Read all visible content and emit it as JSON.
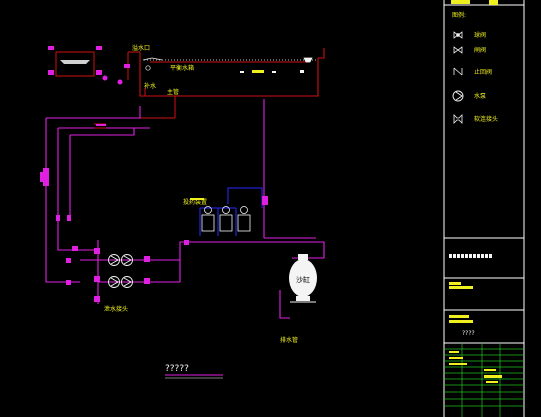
{
  "colors": {
    "background": "#000000",
    "supply_pipe": "#d01010",
    "circulation_pipe": "#e020e0",
    "dosing_pipe": "#2a2aff",
    "frame": "#ffffff",
    "table_line": "#20c020",
    "annotation": "#f0f020"
  },
  "labels": {
    "overflow_port": "溢水口",
    "balance_tank": "平衡水箱",
    "makeup_water": "补水",
    "main_pipe": "主管",
    "dosing_device": "投药装置",
    "drain_outlet": "泄水接头",
    "filter_tank": "沙缸",
    "sewage": "排水管",
    "diagram_title": "?????"
  },
  "legend": {
    "title": "图例:",
    "items": [
      {
        "icon": "ball-valve-icon",
        "label": "球阀"
      },
      {
        "icon": "gate-valve-icon",
        "label": "闸阀"
      },
      {
        "icon": "check-valve-icon",
        "label": "止回阀"
      },
      {
        "icon": "pump-icon",
        "label": "水泵"
      },
      {
        "icon": "flexible-joint-icon",
        "label": "软连接头"
      }
    ]
  },
  "title_block": {
    "blurred_note": "????",
    "blurred_caption": "?????"
  }
}
